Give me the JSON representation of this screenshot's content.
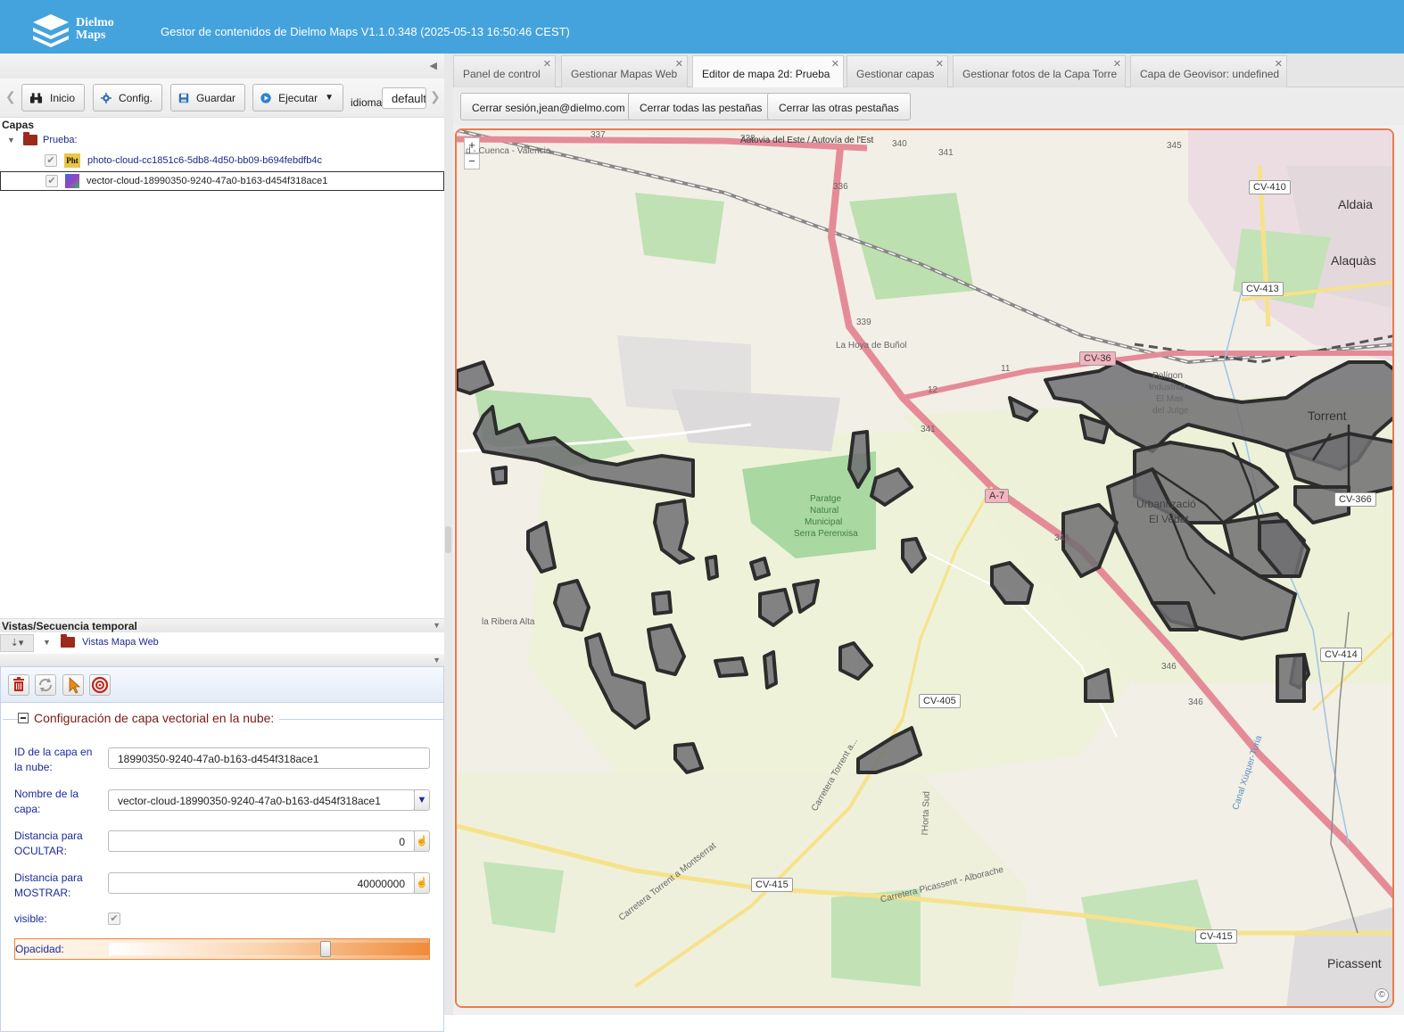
{
  "header": {
    "logo_line1": "Dielmo",
    "logo_line2": "Maps",
    "title": "Gestor de contenidos de Dielmo Maps V1.1.0.348 (2025-05-13 16:50:46 CEST)"
  },
  "toolbar": {
    "inicio": "Inicio",
    "config": "Config.",
    "guardar": "Guardar",
    "ejecutar": "Ejecutar",
    "idioma_label": "idioma:",
    "idioma_value": "default"
  },
  "layers": {
    "title": "Capas",
    "folder": "Prueba:",
    "items": [
      {
        "label": "photo-cloud-cc1851c6-5db8-4d50-bb09-b694febdfb4c",
        "icon_text": "Pht"
      },
      {
        "label": "vector-cloud-18990350-9240-47a0-b163-d454f318ace1"
      }
    ]
  },
  "views": {
    "title": "Vistas/Secuencia temporal",
    "folder": "Vistas Mapa Web"
  },
  "config": {
    "legend": "Configuración de capa vectorial en la nube:",
    "fields": {
      "cloud_id_label": "ID de la capa en la nube:",
      "cloud_id_value": "18990350-9240-47a0-b163-d454f318ace1",
      "name_label": "Nombre de la capa:",
      "name_value": "vector-cloud-18990350-9240-47a0-b163-d454f318ace1",
      "hide_label": "Distancia para OCULTAR:",
      "hide_value": "0",
      "show_label": "Distancia para MOSTRAR:",
      "show_value": "40000000",
      "visible_label": "visible:",
      "visible_checked": true,
      "opacity_label": "Opacidad:",
      "opacity_fraction": 0.68
    }
  },
  "tabs": [
    {
      "label": "Panel de control"
    },
    {
      "label": "Gestionar Mapas Web"
    },
    {
      "label": "Editor de mapa 2d: Prueba",
      "active": true
    },
    {
      "label": "Gestionar capas"
    },
    {
      "label": "Gestionar fotos de la Capa Torre"
    },
    {
      "label": "Capa de Geovisor: undefined"
    }
  ],
  "session": {
    "logout": "Cerrar sesión,jean@dielmo.com",
    "close_all": "Cerrar todas las pestañas",
    "close_others": "Cerrar las otras pestañas"
  },
  "map": {
    "zoom_in": "+",
    "zoom_out": "−",
    "attribution": "©",
    "places": {
      "aldaia": "Aldaia",
      "alaquas": "Alaquàs",
      "torrent": "Torrent",
      "picassent": "Picassent",
      "urbanizacio": "Urbanització",
      "el_vedat": "El Vedat",
      "ribera": "la Ribera Alta",
      "hoya": "La Hoya de Buñol",
      "poligon1": "Polígon",
      "poligon2": "Industrial",
      "poligon3": "El Mas",
      "poligon4": "del Jutge",
      "paratge1": "Paratge",
      "paratge2": "Natural",
      "paratge3": "Municipal",
      "paratge4": "Serra Perenxisa",
      "autovia": "Autovia del Este / Autovía de l'Est",
      "cuenca": "d - Cuenca - Valencia",
      "carretera_torrent": "Carretera Torrent a Montserrat",
      "carretera_picassent": "Carretera Picassent - Alborache",
      "carretera_torrent2": "Carretera Torrent a...",
      "horta_sud": "l'Horta Sud",
      "xuquer": "Canal Xúquer-Turia"
    },
    "roads": {
      "cv410": "CV-410",
      "cv413": "CV-413",
      "cv36": "CV-36",
      "cv366": "CV-366",
      "cv414": "CV-414",
      "cv405": "CV-405",
      "cv415a": "CV-415",
      "cv415b": "CV-415",
      "a7": "A-7",
      "r337": "337",
      "r338": "338",
      "r340": "340",
      "r341": "341",
      "r345": "345",
      "r336": "336",
      "r339": "339",
      "r341b": "341",
      "r344": "344",
      "r346": "346",
      "r346b": "346",
      "r12": "12",
      "r11": "11"
    }
  }
}
